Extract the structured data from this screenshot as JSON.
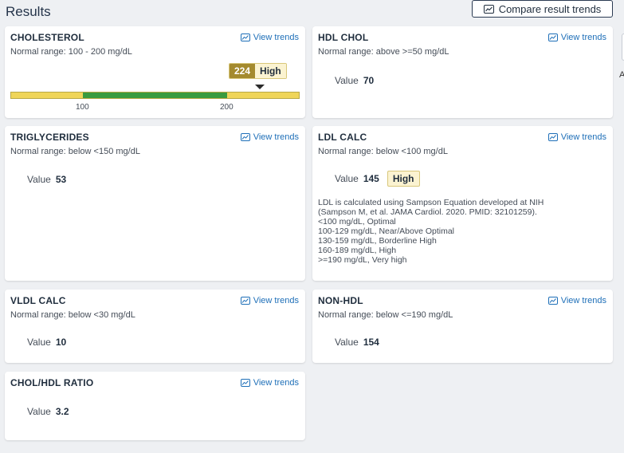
{
  "page": {
    "title": "Results",
    "compare_label": "Compare result trends",
    "edge_letter": "A"
  },
  "view_trends_label": "View trends",
  "value_label": "Value",
  "cards": {
    "cholesterol": {
      "title": "CHOLESTEROL",
      "range": "Normal range: 100 - 200 mg/dL",
      "value": "224",
      "flag": "High",
      "gauge": {
        "ticks": [
          "100",
          "200"
        ],
        "marker_value": 224,
        "colors": {
          "out_of_range": "#efd559",
          "in_range": "#3a9b3f",
          "flag_value_bg": "#a48a2e"
        }
      }
    },
    "hdl": {
      "title": "HDL CHOL",
      "range": "Normal range: above >=50 mg/dL",
      "value": "70"
    },
    "triglycerides": {
      "title": "TRIGLYCERIDES",
      "range": "Normal range: below <150 mg/dL",
      "value": "53"
    },
    "ldl": {
      "title": "LDL CALC",
      "range": "Normal range: below <100 mg/dL",
      "value": "145",
      "flag": "High",
      "note": [
        "LDL is calculated using Sampson Equation developed at NIH",
        "(Sampson M, et al. JAMA Cardiol. 2020. PMID: 32101259).",
        "<100 mg/dL, Optimal",
        "100-129 mg/dL, Near/Above Optimal",
        "130-159 mg/dL, Borderline High",
        "160-189 mg/dL, High",
        ">=190 mg/dL, Very high"
      ]
    },
    "vldl": {
      "title": "VLDL CALC",
      "range": "Normal range: below <30 mg/dL",
      "value": "10"
    },
    "nonhdl": {
      "title": "NON-HDL",
      "range": "Normal range: below <=190 mg/dL",
      "value": "154"
    },
    "ratio": {
      "title": "CHOL/HDL RATIO",
      "value": "3.2"
    }
  },
  "colors": {
    "link": "#1e6fb8",
    "high_badge_bg": "#fbf3d1",
    "background": "#eef0f3"
  },
  "icons": [
    "trend-chart-icon"
  ]
}
